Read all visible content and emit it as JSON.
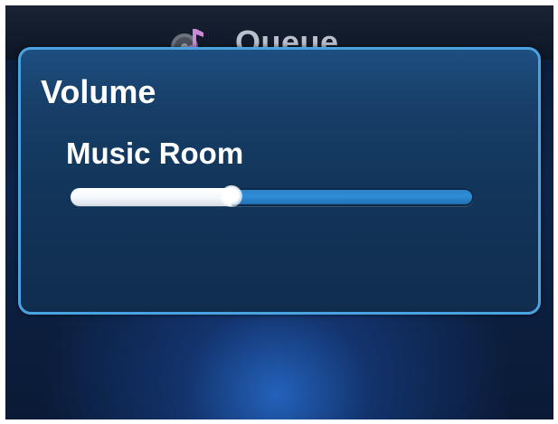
{
  "header": {
    "title": "Queue",
    "icon": "music-queue-icon"
  },
  "dialog": {
    "title": "Volume",
    "room_label": "Music Room",
    "volume_fraction": 0.4
  },
  "colors": {
    "accent": "#4aa3e0",
    "track": "#2d8ed8",
    "background": "#0e2448"
  }
}
